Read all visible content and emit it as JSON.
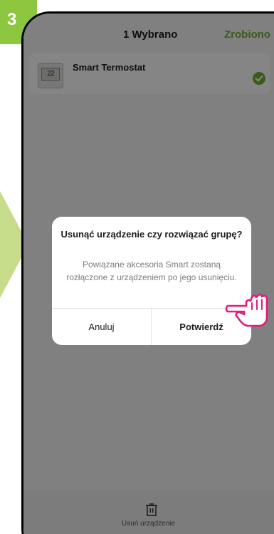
{
  "step": {
    "number": "3",
    "color": "#8dc63f"
  },
  "header": {
    "title": "1  Wybrano",
    "done_label": "Zrobiono",
    "accent_color": "#6fb134"
  },
  "device": {
    "name": "Smart Termostat",
    "icon": "thermostat-icon",
    "icon_display": "22",
    "selected": true
  },
  "dialog": {
    "title": "Usunąć urządzenie czy rozwiązać grupę?",
    "message": "Powiązane akcesoria Smart zostaną rozłączone z urządzeniem po jego usunięciu.",
    "cancel_label": "Anuluj",
    "confirm_label": "Potwierdź"
  },
  "bottom_bar": {
    "remove_label": "Usuń urządzenie",
    "icon": "trash-icon"
  },
  "pointer": {
    "icon": "hand-pointer-icon",
    "color": "#e5197e"
  }
}
